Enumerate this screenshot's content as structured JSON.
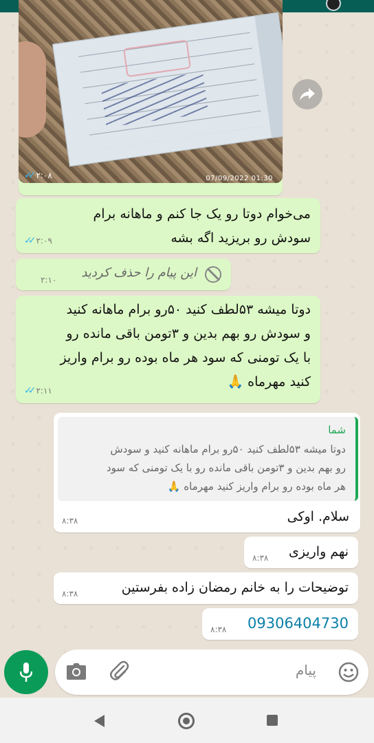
{
  "image_message": {
    "photo_timestamp": "07/09/2022 01:30",
    "time": "۲:۰۸"
  },
  "messages": [
    {
      "direction": "out",
      "text": "می‌خوام دوتا رو یک جا کنم و ماهانه برام\nسودش رو بریزید اگه بشه",
      "time": "۲:۰۹"
    },
    {
      "direction": "out",
      "deleted": true,
      "text": "این پیام را حذف کردید",
      "time": "۲:۱۰"
    },
    {
      "direction": "out",
      "text": "دوتا میشه ۵۳لطف کنید ۵۰رو برام ماهانه کنید\nو سودش رو بهم بدین و ۳تومن باقی مانده رو\nبا یک تومنی که سود هر ماه بوده رو برام واریز\nکنید مهرماه 🙏",
      "time": "۲:۱۱"
    },
    {
      "direction": "in",
      "quote": {
        "author": "شما",
        "text": "دوتا میشه ۵۳لطف کنید ۵۰رو برام ماهانه کنید و سودش\nرو بهم بدین و ۳تومن باقی مانده رو با یک تومنی که سود\nهر ماه بوده رو برام واریز کنید مهرماه 🙏"
      },
      "text": "سلام. اوکی",
      "time": "۸:۳۸"
    },
    {
      "direction": "in",
      "text": "نهم واریزی",
      "time": "۸:۳۸"
    },
    {
      "direction": "in",
      "text": "توضیحات را به خانم رمضان زاده بفرستین",
      "time": "۸:۳۸"
    },
    {
      "direction": "in",
      "text": "09306404730",
      "time": "۸:۳۸"
    }
  ],
  "input": {
    "placeholder": "پیام"
  },
  "icons": {
    "mic": "microphone-icon",
    "camera": "camera-icon",
    "attach": "paperclip-icon",
    "emoji": "emoji-icon",
    "forward": "forward-icon"
  },
  "colors": {
    "accent": "#0a9b58",
    "outgoing_bubble": "#dcf8c6",
    "incoming_bubble": "#ffffff",
    "ticks": "#34b7f1"
  }
}
